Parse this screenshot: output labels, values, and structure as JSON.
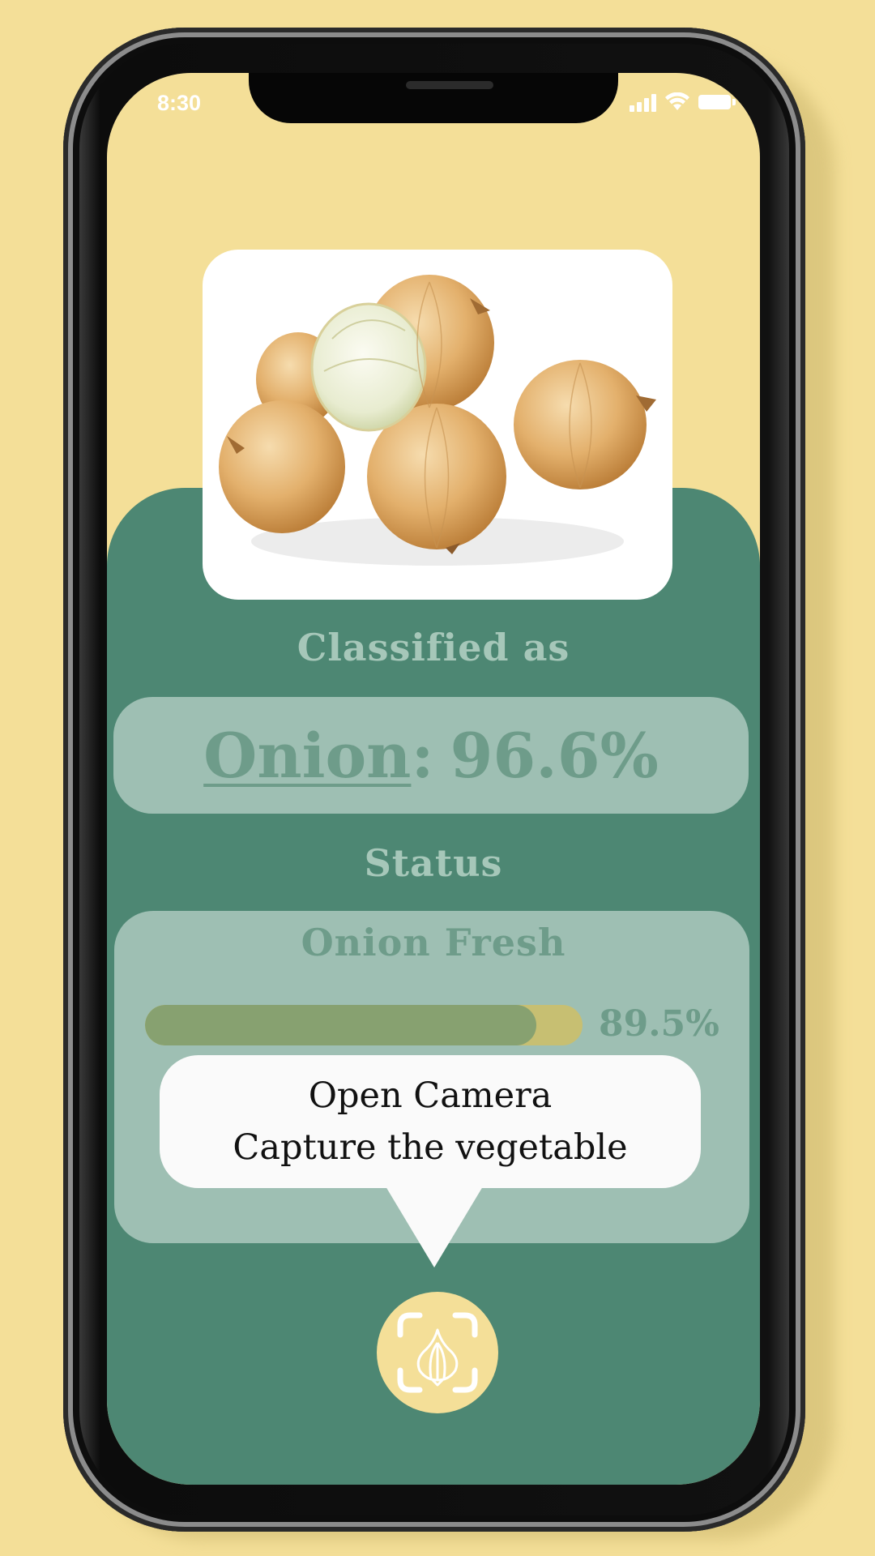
{
  "status_bar": {
    "time": "8:30",
    "icons": [
      "signal-icon",
      "wifi-icon",
      "battery-icon"
    ]
  },
  "photo": {
    "subject": "onion-photo"
  },
  "classification": {
    "label": "Classified as",
    "name": "Onion",
    "separator": ":",
    "confidence": "96.6%"
  },
  "status": {
    "label": "Status",
    "title": "Onion Fresh",
    "freshness_value": "89.5%",
    "freshness_fraction": 0.895
  },
  "tooltip": {
    "line1": "Open Camera",
    "line2": "Capture the vegetable"
  },
  "camera_button": {
    "icon": "scan-garlic-icon"
  },
  "colors": {
    "background": "#f4df98",
    "panel": "#4d8773",
    "card": "#9ebfb3",
    "text_muted": "#6e9c8a",
    "label_text": "#a6c7b9",
    "bar_fill": "#87a170",
    "bar_track": "#c7bf72"
  }
}
